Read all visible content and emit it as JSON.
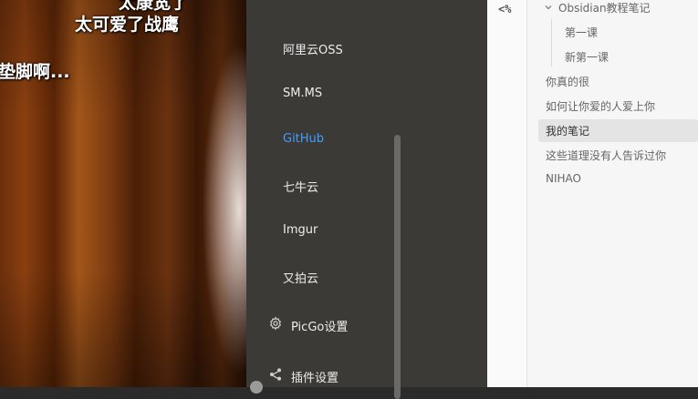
{
  "photo": {
    "meme_lines": [
      "太康宽了",
      "太可爱了战鹰",
      "垫脚啊..."
    ]
  },
  "picgo": {
    "image_hosts": [
      {
        "label": "阿里云OSS",
        "active": false
      },
      {
        "label": "SM.MS",
        "active": false
      },
      {
        "label": "GitHub",
        "active": true
      },
      {
        "label": "七牛云",
        "active": false
      },
      {
        "label": "Imgur",
        "active": false
      },
      {
        "label": "又拍云",
        "active": false
      }
    ],
    "settings_label": "PicGo设置",
    "plugins_label": "插件设置",
    "accent_color": "#409eff"
  },
  "obsidian": {
    "code_button": "<%",
    "folder": "Obsidian教程笔记",
    "folder_children": [
      "第一课",
      "新第一课"
    ],
    "notes": [
      "你真的很",
      "如何让你爱的人爱上你",
      "我的笔记",
      "这些道理没有人告诉过你",
      "NIHAO"
    ],
    "selected_note": "我的笔记"
  }
}
